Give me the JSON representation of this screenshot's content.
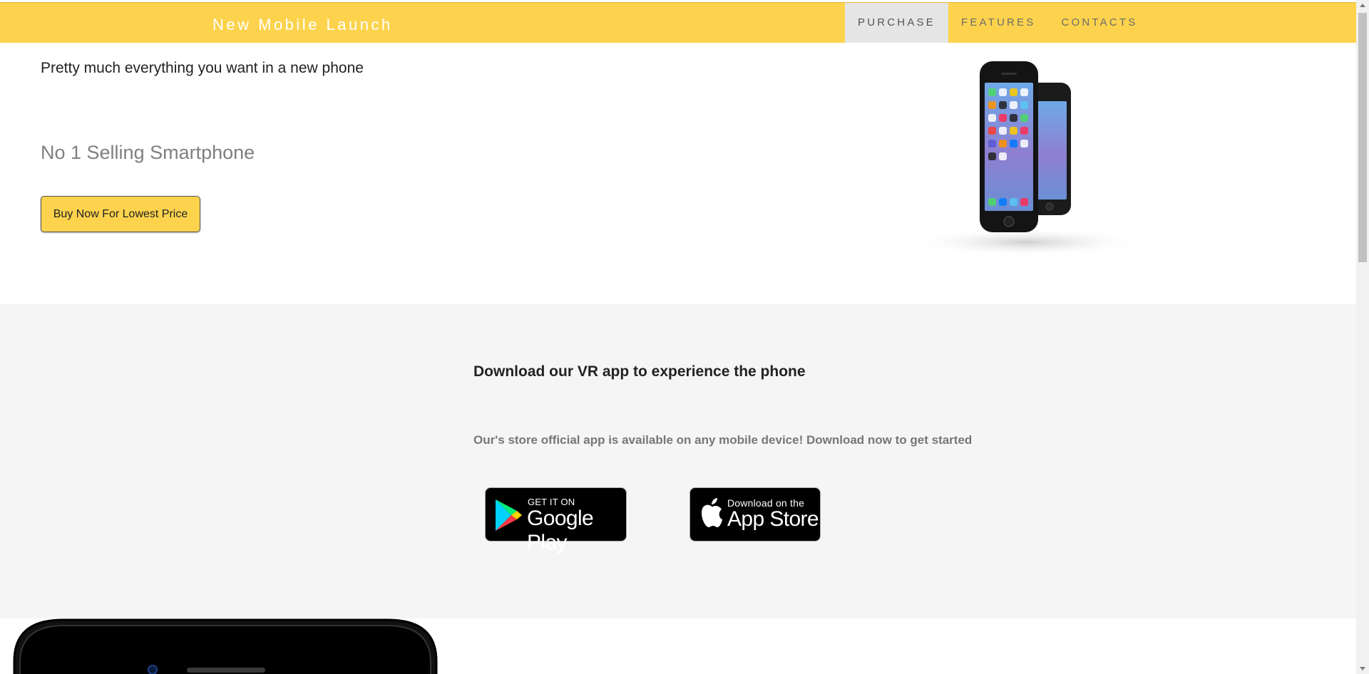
{
  "header": {
    "brand": "New Mobile Launch",
    "nav": [
      {
        "label": "PURCHASE",
        "active": true
      },
      {
        "label": "FEATURES",
        "active": false
      },
      {
        "label": "CONTACTS",
        "active": false
      }
    ]
  },
  "hero": {
    "tagline": "Pretty much everything you want in a new phone",
    "subtitle": "No 1 Selling Smartphone",
    "buy_button": "Buy Now For Lowest Price",
    "image_icon": "phones-image"
  },
  "download": {
    "title": "Download our VR app to experience the phone",
    "text": "Our's store official app is available on any mobile device! Download now to get started",
    "google_badge": {
      "small": "GET IT ON",
      "big": "Google Play",
      "icon": "google-play-icon"
    },
    "apple_badge": {
      "small": "Download on the",
      "big": "App Store",
      "icon": "apple-icon"
    }
  },
  "colors": {
    "accent": "#fdd34d",
    "section_bg": "#f5f5f5",
    "nav_active_bg": "#e5e5e5"
  }
}
